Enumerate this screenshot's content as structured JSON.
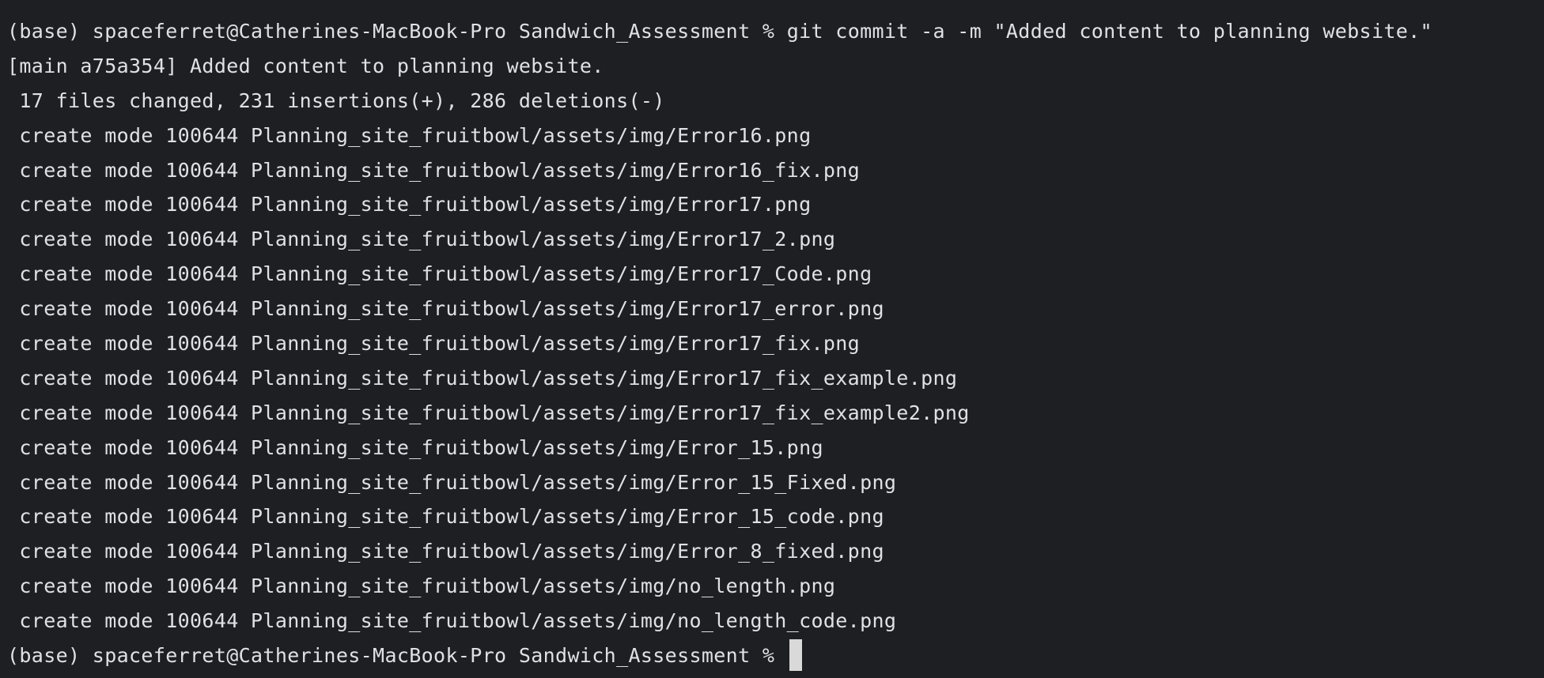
{
  "terminal": {
    "background_color": "#1e1f22",
    "text_color": "#dfe1e5",
    "cursor_color": "#d9d9d9",
    "commit_command": {
      "prompt": "(base) spaceferret@Catherines-MacBook-Pro Sandwich_Assessment % ",
      "command": "git commit -a -m \"Added content to planning website.\""
    },
    "commit_result": "[main a75a354] Added content to planning website.",
    "summary": " 17 files changed, 231 insertions(+), 286 deletions(-)",
    "created_files": [
      " create mode 100644 Planning_site_fruitbowl/assets/img/Error16.png",
      " create mode 100644 Planning_site_fruitbowl/assets/img/Error16_fix.png",
      " create mode 100644 Planning_site_fruitbowl/assets/img/Error17.png",
      " create mode 100644 Planning_site_fruitbowl/assets/img/Error17_2.png",
      " create mode 100644 Planning_site_fruitbowl/assets/img/Error17_Code.png",
      " create mode 100644 Planning_site_fruitbowl/assets/img/Error17_error.png",
      " create mode 100644 Planning_site_fruitbowl/assets/img/Error17_fix.png",
      " create mode 100644 Planning_site_fruitbowl/assets/img/Error17_fix_example.png",
      " create mode 100644 Planning_site_fruitbowl/assets/img/Error17_fix_example2.png",
      " create mode 100644 Planning_site_fruitbowl/assets/img/Error_15.png",
      " create mode 100644 Planning_site_fruitbowl/assets/img/Error_15_Fixed.png",
      " create mode 100644 Planning_site_fruitbowl/assets/img/Error_15_code.png",
      " create mode 100644 Planning_site_fruitbowl/assets/img/Error_8_fixed.png",
      " create mode 100644 Planning_site_fruitbowl/assets/img/no_length.png",
      " create mode 100644 Planning_site_fruitbowl/assets/img/no_length_code.png"
    ],
    "final_prompt": "(base) spaceferret@Catherines-MacBook-Pro Sandwich_Assessment % "
  }
}
